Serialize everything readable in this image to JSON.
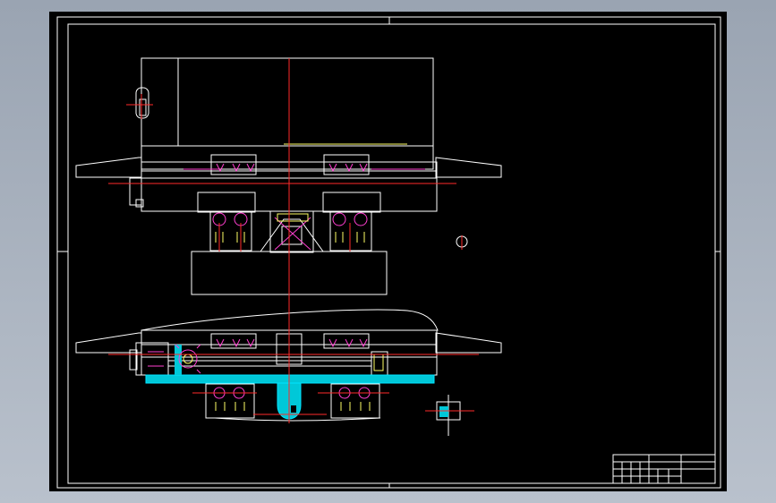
{
  "drawing": {
    "background": "#000000",
    "frame_color": "#ffffff",
    "centerline_color": "#ff2a2a",
    "section_color": "#00e5ff",
    "hardware_color": "#ff3fd0",
    "highlight_color": "#ffff66"
  }
}
